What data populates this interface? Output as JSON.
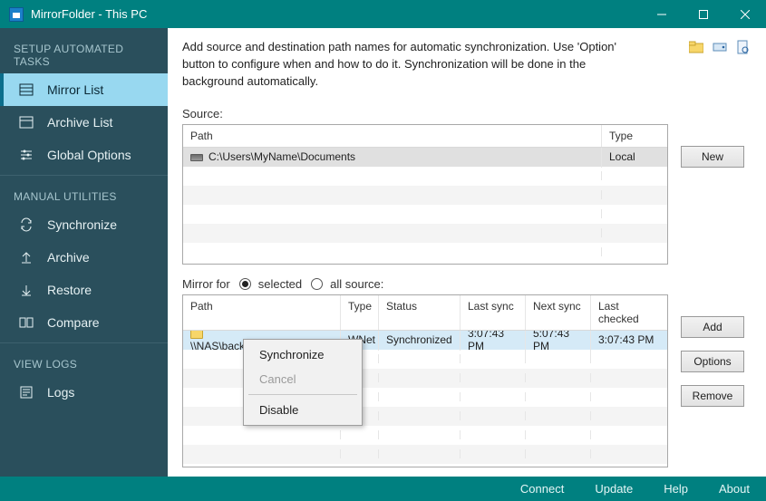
{
  "window": {
    "title": "MirrorFolder - This PC"
  },
  "sidebar": {
    "headers": {
      "setup": "SETUP AUTOMATED TASKS",
      "manual": "MANUAL UTILITIES",
      "logs": "VIEW LOGS"
    },
    "items": {
      "mirror_list": "Mirror List",
      "archive_list": "Archive List",
      "global_options": "Global Options",
      "synchronize": "Synchronize",
      "archive": "Archive",
      "restore": "Restore",
      "compare": "Compare",
      "logs": "Logs"
    }
  },
  "content": {
    "intro": "Add source and destination path names for automatic synchronization. Use 'Option' button to configure when and how to do it. Synchronization will be done in the background automatically.",
    "source_label": "Source:",
    "mirror_label_prefix": "Mirror for",
    "radio_selected": "selected",
    "radio_all": "all source:"
  },
  "source_grid": {
    "headers": {
      "path": "Path",
      "type": "Type"
    },
    "rows": [
      {
        "path": "C:\\Users\\MyName\\Documents",
        "type": "Local"
      }
    ]
  },
  "mirror_grid": {
    "headers": {
      "path": "Path",
      "type": "Type",
      "status": "Status",
      "last_sync": "Last sync",
      "next_sync": "Next sync",
      "last_checked": "Last checked"
    },
    "rows": [
      {
        "path": "\\\\NAS\\backup\\Documents",
        "type": "WNet",
        "status": "Synchronized",
        "last_sync": "3:07:43 PM",
        "next_sync": "5:07:43 PM",
        "last_checked": "3:07:43 PM"
      }
    ]
  },
  "buttons": {
    "new": "New",
    "add": "Add",
    "options": "Options",
    "remove": "Remove"
  },
  "context_menu": {
    "synchronize": "Synchronize",
    "cancel": "Cancel",
    "disable": "Disable"
  },
  "statusbar": {
    "connect": "Connect",
    "update": "Update",
    "help": "Help",
    "about": "About"
  }
}
